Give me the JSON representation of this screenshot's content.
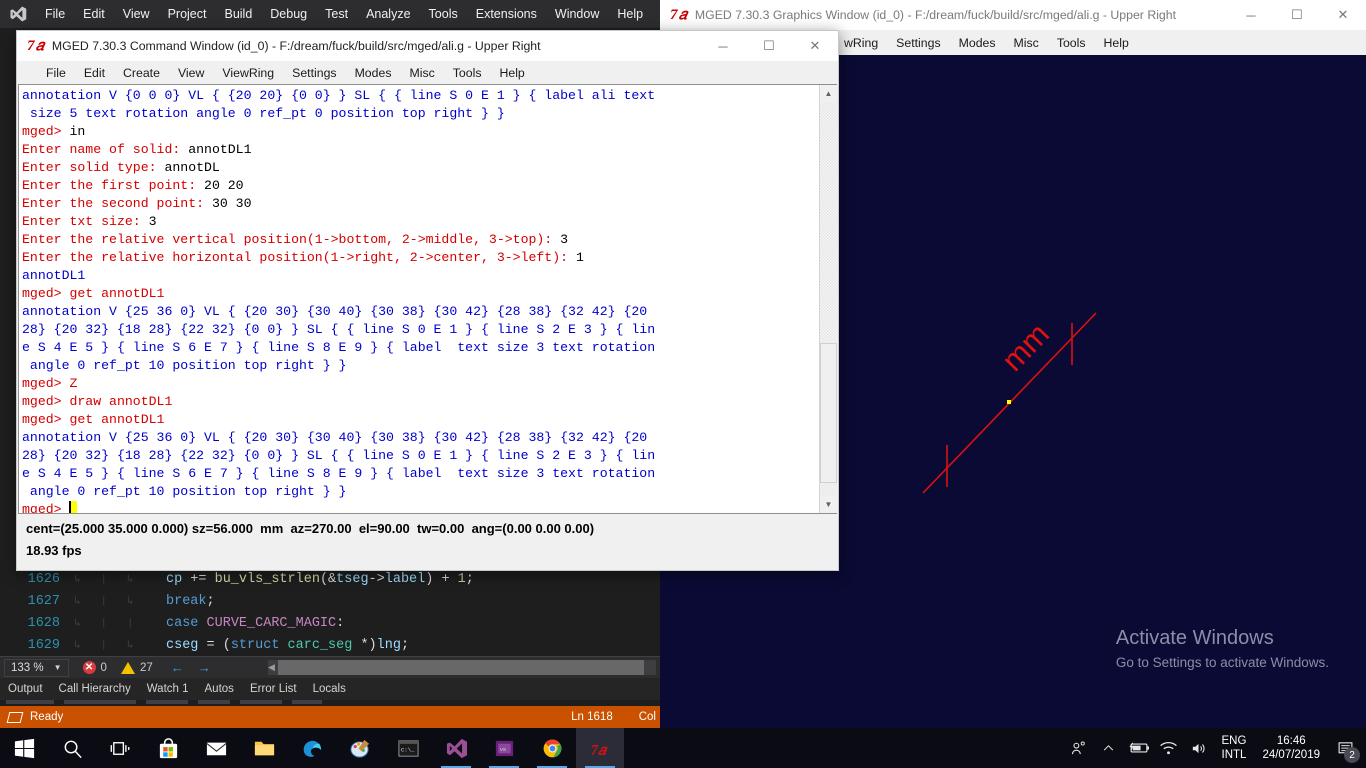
{
  "vs": {
    "menu": [
      "File",
      "Edit",
      "View",
      "Project",
      "Build",
      "Debug",
      "Test",
      "Analyze",
      "Tools",
      "Extensions",
      "Window",
      "Help"
    ],
    "code_lines": [
      {
        "number": "1626",
        "text": "cp += bu_vls_strlen(&tseg->label) + 1;"
      },
      {
        "number": "1627",
        "text": "break;"
      },
      {
        "number": "1628",
        "text": "case CURVE_CARC_MAGIC:"
      },
      {
        "number": "1629",
        "text": "cseg = (struct carc_seg *)lng;"
      }
    ],
    "zoom_level": "133 %",
    "error_count": "0",
    "warning_count": "27",
    "panel_tabs": [
      "Output",
      "Call Hierarchy",
      "Watch 1",
      "Autos",
      "Error List",
      "Locals"
    ],
    "status": {
      "ready": "Ready",
      "line": "Ln 1618",
      "col": "Col"
    }
  },
  "graphics_window": {
    "title": "MGED 7.30.3 Graphics Window (id_0) - F:/dream/fuck/build/src/mged/ali.g - Upper Right",
    "menu": [
      "wRing",
      "Settings",
      "Modes",
      "Misc",
      "Tools",
      "Help"
    ],
    "window_buttons": {
      "minimize": "─",
      "maximize": "☐",
      "close": "✕"
    },
    "annotation_label": "mm",
    "line_color": "#e01010",
    "point_color": "#ffff00",
    "background_color": "#0a0a35"
  },
  "activate_windows": {
    "title": "Activate Windows",
    "subtitle": "Go to Settings to activate Windows."
  },
  "command_window": {
    "title": "MGED 7.30.3 Command Window (id_0) - F:/dream/fuck/build/src/mged/ali.g - Upper Right",
    "menu": [
      "File",
      "Edit",
      "Create",
      "View",
      "ViewRing",
      "Settings",
      "Modes",
      "Misc",
      "Tools",
      "Help"
    ],
    "window_buttons": {
      "minimize": "─",
      "maximize": "☐",
      "close": "✕"
    },
    "terminal_lines": [
      [
        {
          "t": "annotation V {0 0 0} VL { {20 20} {0 0} } SL { { line S 0 E 1 } { label ali text",
          "c": "blue"
        }
      ],
      [
        {
          "t": " size 5 text rotation angle 0 ref_pt 0 position top right } }",
          "c": "blue"
        }
      ],
      [
        {
          "t": "mged> ",
          "c": "red"
        },
        {
          "t": "in",
          "c": "blk"
        }
      ],
      [
        {
          "t": "Enter name of solid: ",
          "c": "red"
        },
        {
          "t": "annotDL1",
          "c": "blk"
        }
      ],
      [
        {
          "t": "Enter solid type: ",
          "c": "red"
        },
        {
          "t": "annotDL",
          "c": "blk"
        }
      ],
      [
        {
          "t": "Enter the first point: ",
          "c": "red"
        },
        {
          "t": "20 20",
          "c": "blk"
        }
      ],
      [
        {
          "t": "Enter the second point: ",
          "c": "red"
        },
        {
          "t": "30 30",
          "c": "blk"
        }
      ],
      [
        {
          "t": "Enter txt size: ",
          "c": "red"
        },
        {
          "t": "3",
          "c": "blk"
        }
      ],
      [
        {
          "t": "Enter the relative vertical position(1->bottom, 2->middle, 3->top): ",
          "c": "red"
        },
        {
          "t": "3",
          "c": "blk"
        }
      ],
      [
        {
          "t": "Enter the relative horizontal position(1->right, 2->center, 3->left): ",
          "c": "red"
        },
        {
          "t": "1",
          "c": "blk"
        }
      ],
      [
        {
          "t": "annotDL1",
          "c": "blue"
        }
      ],
      [
        {
          "t": "mged> ",
          "c": "red"
        },
        {
          "t": "get annotDL1",
          "c": "red"
        }
      ],
      [
        {
          "t": "annotation V {25 36 0} VL { {20 30} {30 40} {30 38} {30 42} {28 38} {32 42} {20",
          "c": "blue"
        }
      ],
      [
        {
          "t": "28} {20 32} {18 28} {22 32} {0 0} } SL { { line S 0 E 1 } { line S 2 E 3 } { lin",
          "c": "blue"
        }
      ],
      [
        {
          "t": "e S 4 E 5 } { line S 6 E 7 } { line S 8 E 9 } { label  text size 3 text rotation",
          "c": "blue"
        }
      ],
      [
        {
          "t": " angle 0 ref_pt 10 position top right } }",
          "c": "blue"
        }
      ],
      [
        {
          "t": "mged> ",
          "c": "red"
        },
        {
          "t": "Z",
          "c": "red"
        }
      ],
      [
        {
          "t": "mged> ",
          "c": "red"
        },
        {
          "t": "draw annotDL1",
          "c": "red"
        }
      ],
      [
        {
          "t": "mged> ",
          "c": "red"
        },
        {
          "t": "get annotDL1",
          "c": "red"
        }
      ],
      [
        {
          "t": "annotation V {25 36 0} VL { {20 30} {30 40} {30 38} {30 42} {28 38} {32 42} {20",
          "c": "blue"
        }
      ],
      [
        {
          "t": "28} {20 32} {18 28} {22 32} {0 0} } SL { { line S 0 E 1 } { line S 2 E 3 } { lin",
          "c": "blue"
        }
      ],
      [
        {
          "t": "e S 4 E 5 } { line S 6 E 7 } { line S 8 E 9 } { label  text size 3 text rotation",
          "c": "blue"
        }
      ],
      [
        {
          "t": " angle 0 ref_pt 10 position top right } }",
          "c": "blue"
        }
      ],
      [
        {
          "t": "mged> ",
          "c": "red"
        }
      ]
    ],
    "status_line_1": "cent=(25.000 35.000 0.000) sz=56.000  mm  az=270.00  el=90.00  tw=0.00  ang=(0.00 0.00 0.00)",
    "status_line_2": "18.93 fps"
  },
  "taskbar": {
    "items": [
      {
        "name": "start-button",
        "icon": "windows-logo"
      },
      {
        "name": "search-button",
        "icon": "search-icon"
      },
      {
        "name": "task-view-button",
        "icon": "task-view-icon"
      },
      {
        "name": "microsoft-store",
        "icon": "store-icon"
      },
      {
        "name": "mail",
        "icon": "mail-icon"
      },
      {
        "name": "file-explorer",
        "icon": "folder-icon"
      },
      {
        "name": "microsoft-edge",
        "icon": "edge-icon"
      },
      {
        "name": "paint",
        "icon": "paint-icon"
      },
      {
        "name": "command-prompt",
        "icon": "terminal-icon"
      },
      {
        "name": "visual-studio",
        "icon": "visual-studio-icon"
      },
      {
        "name": "visual-studio-installer",
        "icon": "vs-installer-icon"
      },
      {
        "name": "google-chrome",
        "icon": "chrome-icon"
      },
      {
        "name": "mged",
        "icon": "mged-icon"
      }
    ],
    "tray": {
      "language_top": "ENG",
      "language_bottom": "INTL",
      "time": "16:46",
      "date": "24/07/2019",
      "notification_count": "2"
    }
  }
}
